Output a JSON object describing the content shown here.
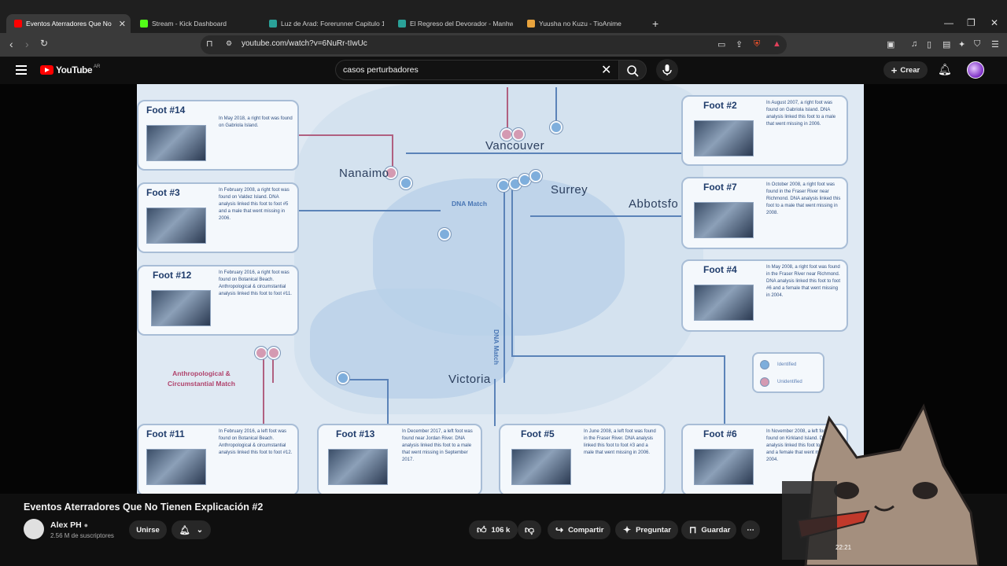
{
  "browser": {
    "tabs": [
      {
        "label": "Eventos Aterradores Que No",
        "favicon_color": "#ff0000",
        "active": true
      },
      {
        "label": "Stream - Kick Dashboard",
        "favicon_color": "#53fc18",
        "active": false
      },
      {
        "label": "Luz de Arad: Forerunner Capitulo 1 e",
        "favicon_color": "#2aa198",
        "active": false
      },
      {
        "label": "El Regreso del Devorador - Manhwa",
        "favicon_color": "#2aa198",
        "active": false
      },
      {
        "label": "Yuusha no Kuzu - TioAnime",
        "favicon_color": "#e8a33d",
        "active": false
      }
    ],
    "new_tab": "+",
    "url": "youtube.com/watch?v=6NuRr-tIwUc"
  },
  "youtube": {
    "logo_text": "YouTube",
    "country_code": "AR",
    "search_query": "casos perturbadores",
    "create_label": "Crear",
    "accent": "#ff0000"
  },
  "video": {
    "map": {
      "cities": {
        "vancouver": "Vancouver",
        "nanaimo": "Nanaimo",
        "surrey": "Surrey",
        "abbotsford": "Abbotsfo",
        "victoria": "Victoria"
      },
      "dna_match_1": "DNA Match",
      "dna_match_2": "DNA Match",
      "anthro_match": "Anthropological & Circumstantial Match",
      "legend": {
        "identified": "Identified",
        "unidentified": "Unidentified",
        "identified_color": "#7eaedc",
        "unidentified_color": "#d49ab2"
      },
      "cards": {
        "foot14": {
          "title": "Foot #14",
          "text": "In May 2018, a right foot was found on Gabriola Island."
        },
        "foot3": {
          "title": "Foot #3",
          "text": "In February 2008, a right foot was found on Valdez Island. DNA analysis linked this foot to foot #5 and a male that went missing in 2006."
        },
        "foot12": {
          "title": "Foot #12",
          "text": "In February 2016, a right foot was found on Botanical Beach. Anthropological & circumstantial analysis linked this foot to foot #11."
        },
        "foot11": {
          "title": "Foot #11",
          "text": "In February 2016, a left foot was found on Botanical Beach. Anthropological & circumstantial analysis linked this foot to foot #12."
        },
        "foot13": {
          "title": "Foot #13",
          "text": "In December 2017, a left foot was found near Jordan River. DNA analysis linked this foot to a male that went missing in September 2017."
        },
        "foot5": {
          "title": "Foot #5",
          "text": "In June 2008, a left foot was found in the Fraser River. DNA analysis linked this foot to foot #3 and a male that went missing in 2006."
        },
        "foot2": {
          "title": "Foot #2",
          "text": "In August 2007, a right foot was found on Gabriola Island. DNA analysis linked this foot to a male that went missing in 2006."
        },
        "foot7": {
          "title": "Foot #7",
          "text": "In October 2008, a right foot was found in the Fraser River near Richmond. DNA analysis linked this foot to a male that went missing in 2008."
        },
        "foot4": {
          "title": "Foot #4",
          "text": "In May 2008, a right foot was found in the Fraser River near Richmond. DNA analysis linked this foot to foot #6 and a female that went missing in 2004."
        },
        "foot6": {
          "title": "Foot #6",
          "text": "In November 2008, a left foot was found on Kirkland Island. DNA analysis linked this foot to foot #4 and a female that went missing in 2004."
        }
      }
    },
    "overlay_timestamp": "22:21"
  },
  "below": {
    "title": "Eventos Aterradores Que No Tienen Explicación #2",
    "channel": "Alex PH",
    "subscribers": "2.56 M de suscriptores",
    "join": "Unirse",
    "likes": "106 k",
    "share": "Compartir",
    "ask": "Preguntar",
    "save": "Guardar",
    "more": "⋯"
  }
}
